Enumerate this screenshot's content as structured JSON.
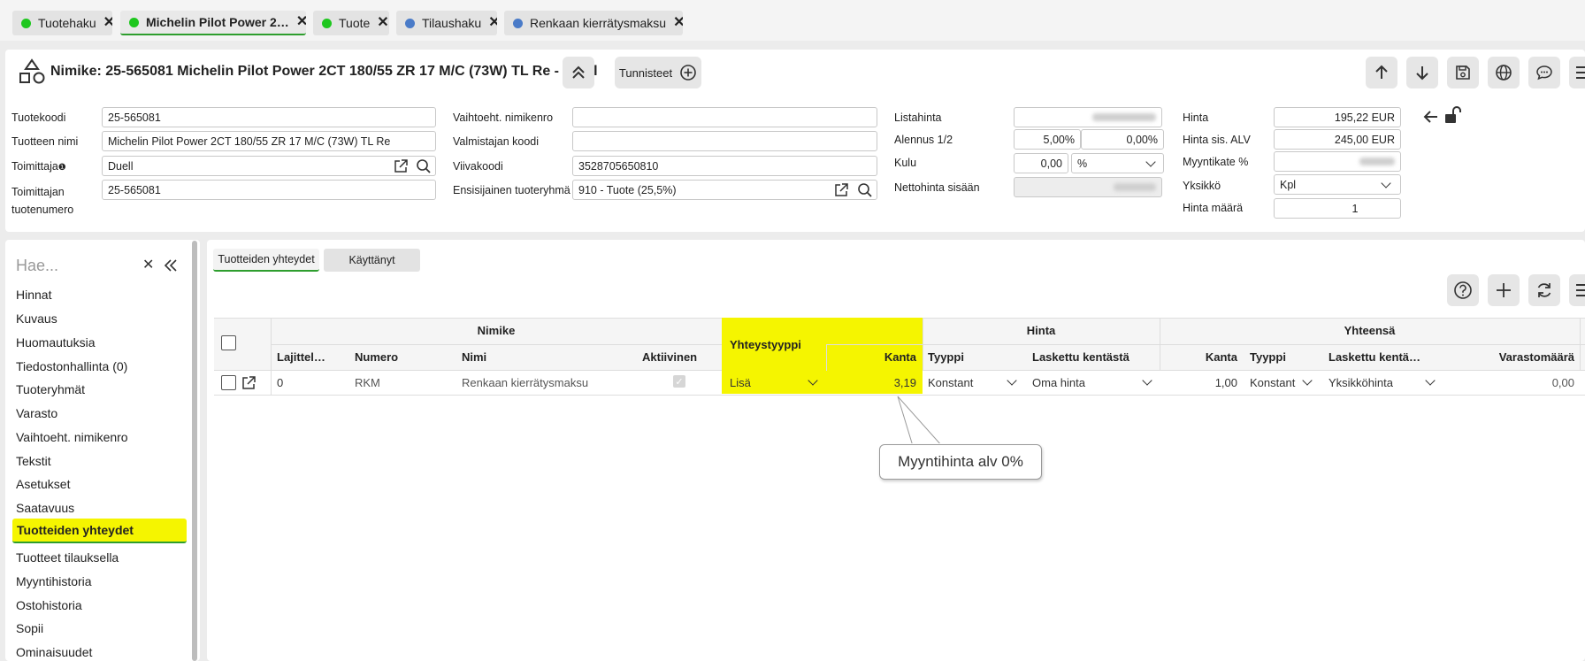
{
  "tabs": [
    {
      "label": "Tuotehaku",
      "color": "#1ec71e"
    },
    {
      "label": "Michelin Pilot Power 2…",
      "color": "#1ec71e"
    },
    {
      "label": "Tuote",
      "color": "#1ec71e"
    },
    {
      "label": "Tilaushaku",
      "color": "#4a7bc8"
    },
    {
      "label": "Renkaan kierrätysmaksu",
      "color": "#4a7bc8"
    }
  ],
  "header": {
    "title": "Nimike: 25-565081 Michelin Pilot Power 2CT 180/55 ZR 17 M/C (73W) TL Re - Duell",
    "tunnisteet": "Tunnisteet"
  },
  "form": {
    "tuotekoodi_label": "Tuotekoodi",
    "tuotekoodi": "25-565081",
    "tuotteen_nimi_label": "Tuotteen nimi",
    "tuotteen_nimi": "Michelin Pilot Power 2CT 180/55 ZR 17 M/C (73W) TL Re",
    "toimittaja_label": "Toimittaja",
    "toimittaja": "Duell",
    "toimittajan_tuotenumero_label": "Toimittajan tuotenumero",
    "toimittajan_tuotenumero": "25-565081",
    "vaihtoeht_label": "Vaihtoeht. nimikenro",
    "valmistajan_label": "Valmistajan koodi",
    "viivakoodi_label": "Viivakoodi",
    "viivakoodi": "3528705650810",
    "tuoteryhma_label": "Ensisijainen tuoteryhmä",
    "tuoteryhma": "910 - Tuote (25,5%)",
    "listahinta_label": "Listahinta",
    "alennus_label": "Alennus 1/2",
    "alennus1": "5,00%",
    "alennus2": "0,00%",
    "kulu_label": "Kulu",
    "kulu": "0,00",
    "kulu_unit": "%",
    "nettohinta_label": "Nettohinta sisään",
    "hinta_label": "Hinta",
    "hinta": "195,22 EUR",
    "hinta_alv_label": "Hinta sis. ALV",
    "hinta_alv": "245,00 EUR",
    "myyntikate_label": "Myyntikate %",
    "yksikko_label": "Yksikkö",
    "yksikko": "Kpl",
    "hinta_maara_label": "Hinta määrä",
    "hinta_maara": "1"
  },
  "sidebar": {
    "search_placeholder": "Hae...",
    "items": [
      "Hinnat",
      "Kuvaus",
      "Huomautuksia",
      "Tiedostonhallinta (0)",
      "Tuoteryhmät",
      "Varasto",
      "Vaihtoeht. nimikenro",
      "Tekstit",
      "Asetukset",
      "Saatavuus",
      "Tuotteiden yhteydet",
      "Tuotteet tilauksella",
      "Myyntihistoria",
      "Ostohistoria",
      "Sopii",
      "Ominaisuudet"
    ],
    "active_index": 10
  },
  "subtabs": [
    "Tuotteiden yhteydet",
    "Käyttänyt"
  ],
  "grid": {
    "groups": {
      "nimike": "Nimike",
      "yhteystyyppi": "Yhteystyyppi",
      "hinta": "Hinta",
      "yhteensa": "Yhteensä"
    },
    "columns": {
      "lajittelu": "Lajittel…",
      "numero": "Numero",
      "nimi": "Nimi",
      "aktiivinen": "Aktiivinen",
      "kanta": "Kanta",
      "tyyppi": "Tyyppi",
      "laskettu": "Laskettu kentästä",
      "kanta2": "Kanta",
      "tyyppi2": "Tyyppi",
      "laskettu2": "Laskettu kentä…",
      "varastomaara": "Varastomäärä"
    },
    "row": {
      "lajittelu": "0",
      "numero": "RKM",
      "nimi": "Renkaan kierrätysmaksu",
      "aktiivinen": true,
      "yhteystyyppi": "Lisä",
      "kanta": "3,19",
      "tyyppi": "Konstant",
      "laskettu": "Oma hinta",
      "kanta2": "1,00",
      "tyyppi2": "Konstant",
      "laskettu2": "Yksikköhinta",
      "varastomaara": "0,00"
    }
  },
  "callout": "Myyntihinta alv 0%",
  "colors": {
    "highlight": "#f5f500",
    "green": "#2e9e2e"
  }
}
